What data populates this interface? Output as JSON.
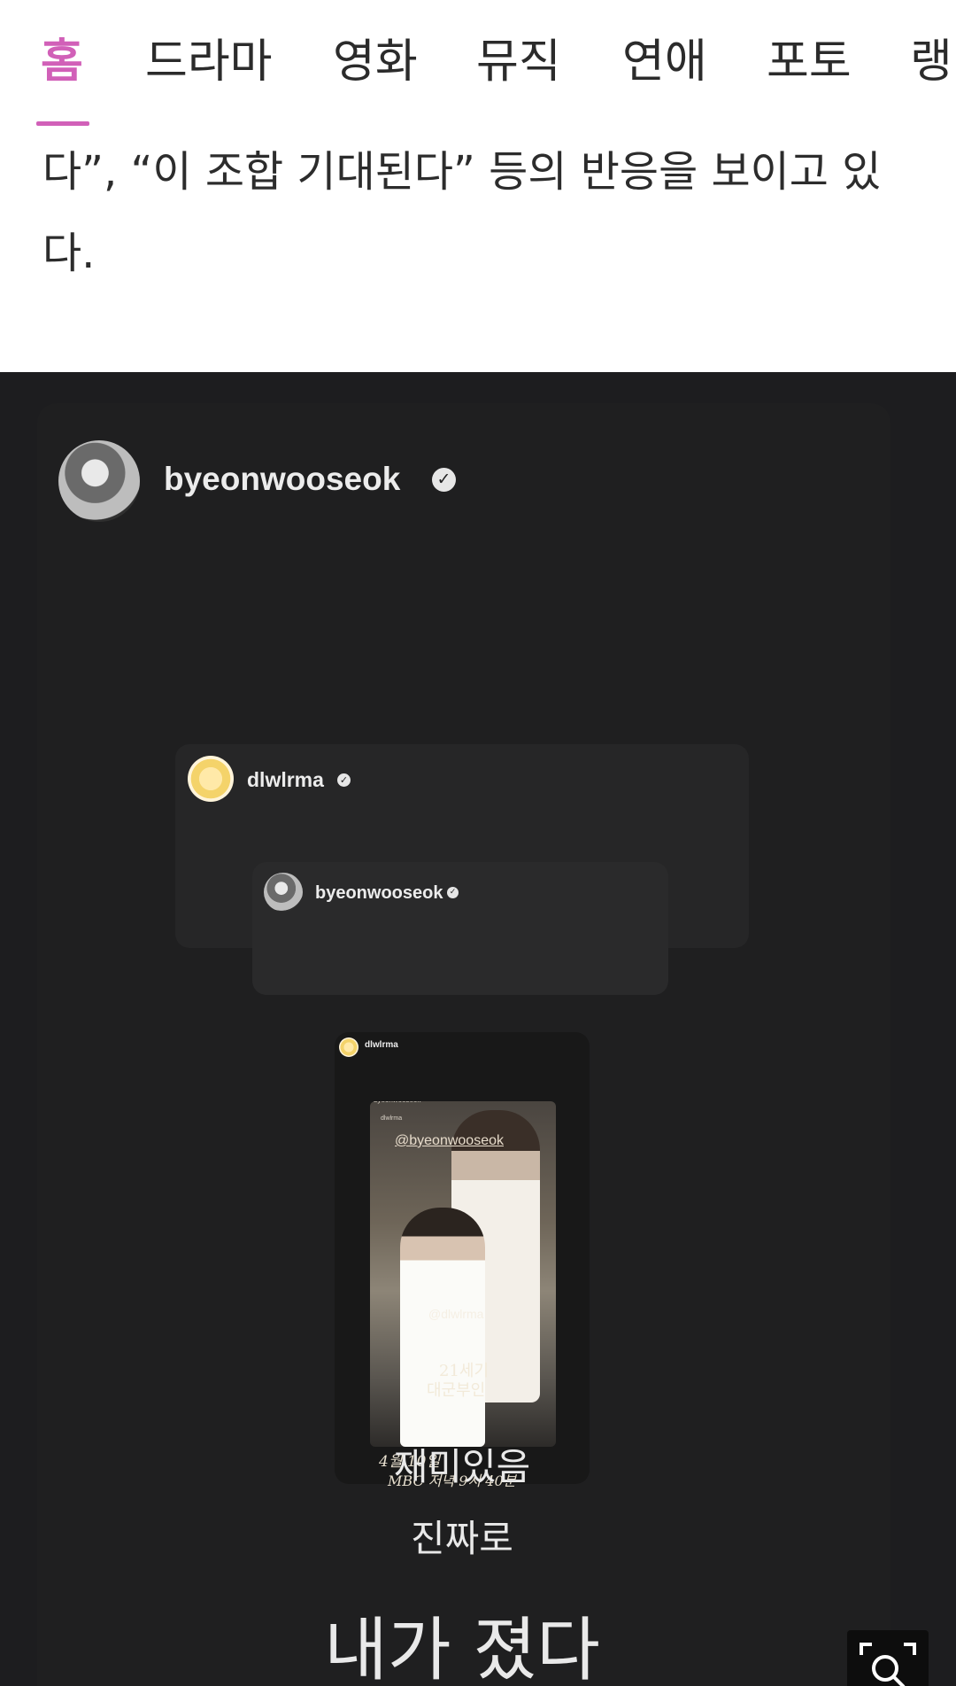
{
  "tabs": [
    {
      "label": "홈",
      "active": true
    },
    {
      "label": "드라마",
      "active": false
    },
    {
      "label": "영화",
      "active": false
    },
    {
      "label": "뮤직",
      "active": false
    },
    {
      "label": "연애",
      "active": false
    },
    {
      "label": "포토",
      "active": false
    },
    {
      "label": "랭",
      "active": false
    }
  ],
  "accent_color": "#d160b8",
  "article": {
    "text": "다”, “이 조합 기대된다” 등의 반응을 보이고 있다."
  },
  "story": {
    "username": "byeonwooseok",
    "verified_icon": "verified-badge-icon",
    "nested": [
      {
        "username": "dlwlrma"
      },
      {
        "username": "byeonwooseok"
      }
    ],
    "inner": {
      "username": "dlwlrma",
      "sub_username_1": "byeonwooseok",
      "sub_username_2": "dlwlrma",
      "mention": "@byeonwooseok",
      "poster_mention": "@dlwlrma",
      "poster_title_1": "21세기",
      "poster_title_2": "대군부인",
      "date": "4월 10일",
      "broadcast": "MBC 저녁 9시 40분"
    },
    "caption_1": "재미있음",
    "caption_2": "진짜로",
    "caption_3": "내가 졌다"
  },
  "zoom_icon": "zoom-in-icon"
}
